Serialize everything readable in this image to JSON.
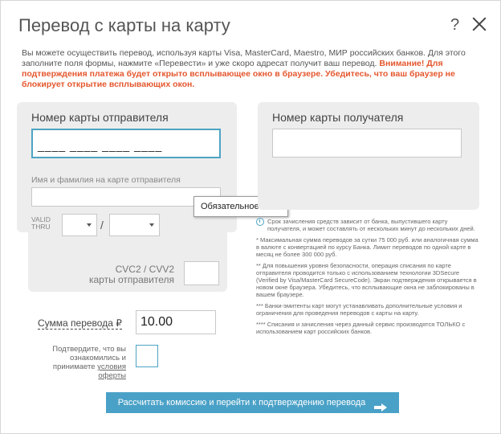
{
  "dialog": {
    "title": "Перевод с карты на карту",
    "help_label": "?"
  },
  "intro": {
    "text": "Вы можете осуществить перевод, используя карты Visa, MasterCard, Maestro, МИР российских банков. Для этого заполните поля формы, нажмите «Перевести» и уже скоро адресат получит ваш перевод.",
    "warning": "Внимание! Для подтверждения платежа будет открыто всплывающее окно в браузере. Убедитесь, что ваш браузер не блокирует открытие всплывающих окон."
  },
  "sender": {
    "title": "Номер карты отправителя",
    "card_number_value": "____ ____ ____ ____",
    "name_label": "Имя и фамилия на карте отправителя",
    "name_value": "",
    "valid_thru_line1": "VALID",
    "valid_thru_line2": "THRU",
    "month_value": "",
    "year_value": "",
    "date_separator": "/",
    "cvc_line1": "CVC2 / CVV2",
    "cvc_line2": "карты отправителя"
  },
  "tooltip": {
    "text": "Обязательное поле"
  },
  "receiver": {
    "title": "Номер карты получателя",
    "card_number_value": ""
  },
  "info": {
    "time_note": "Срок зачисления средств зависит от банка, выпустившего карту получателя, и может составлять от нескольких минут до нескольких дней.",
    "note1": "* Максимальная сумма переводов за сутки 75 000 руб. или аналогичная сумма в валюте с конвертацией по курсу Банка. Лимит переводов по одной карте в месяц не более 300 000 руб.",
    "note2": "** Для повышения уровня безопасности, операция списания по карте отправителя проводится только с использованием технологии 3DSecure (Verified by Visa/MasterCard SecureCode). Экран подтверждения открывается в новом окне браузера. Убедитесь, что всплывающие окна не заблокированы в вашем браузере.",
    "note3": "*** Банки-эмитенты карт могут устанавливать дополнительные условия и ограничения для проведения переводов с карты на карту.",
    "note4": "**** Списания и зачисления через данный сервис производятся ТОЛЬКО с использованием карт российских банков."
  },
  "amount": {
    "label": "Сумма перевода ₽",
    "value": "10.00"
  },
  "agreement": {
    "text": "Подтвердите, что вы ознакомились и принимаете",
    "link": "условия оферты",
    "checked": false
  },
  "submit": {
    "label": "Рассчитать комиссию и перейти к подтверждению перевода"
  },
  "colors": {
    "accent": "#4aa1c7",
    "warning": "#e4572e",
    "panel": "#ededed"
  }
}
